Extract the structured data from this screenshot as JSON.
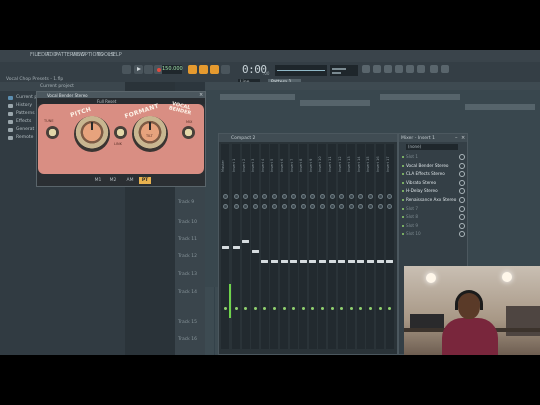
{
  "menu": [
    "FILE",
    "EDIT",
    "ADD",
    "PATTERNS",
    "VIEW",
    "OPTIONS",
    "TOOLS",
    "HELP"
  ],
  "toolbar": {
    "hint": "Vocal Chop Presets - 1.flp",
    "tempo": "150.000",
    "time": "0:00",
    "time_sub": ":00",
    "line_mode": "Line",
    "pattern": "Pattern 1",
    "record_color": "#e04b3f",
    "accent": "#e59a2f"
  },
  "browser": {
    "header": "Current project",
    "items": [
      {
        "label": "Current p",
        "icon": "folder-icon"
      },
      {
        "label": "History",
        "icon": "history-icon"
      },
      {
        "label": "Patterns",
        "icon": "patterns-icon"
      },
      {
        "label": "Effects",
        "icon": "effects-icon"
      },
      {
        "label": "Generat",
        "icon": "generators-icon"
      },
      {
        "label": "Remote",
        "icon": "remote-icon"
      }
    ]
  },
  "tracks": [
    "Track 9",
    "Track 10",
    "Track 11",
    "Track 12",
    "Track 13",
    "Track 14",
    "Track 15",
    "Track 16"
  ],
  "mixer": {
    "title": "Compact 2",
    "strips": [
      "Master",
      "Insert 1",
      "Insert 2",
      "Insert 3",
      "Insert 4",
      "Insert 5",
      "Insert 6",
      "Insert 7",
      "Insert 8",
      "Insert 9",
      "Insert 10",
      "Insert 11",
      "Insert 12",
      "Insert 13",
      "Insert 14",
      "Insert 15",
      "Insert 16",
      "Insert 17"
    ],
    "meter_color": "#6fd34c"
  },
  "insert_panel": {
    "title": "Mixer - Insert 1",
    "input": "(none)",
    "slots": [
      {
        "label": "Slot 1",
        "active": false
      },
      {
        "label": "Vocal Bender Stereo",
        "active": true
      },
      {
        "label": "CLA Effects Stereo",
        "active": true
      },
      {
        "label": "Vibrato Stereo",
        "active": true
      },
      {
        "label": "H-Delay Stereo",
        "active": true
      },
      {
        "label": "Renaissance Axx Stereo",
        "active": true
      },
      {
        "label": "Slot 7",
        "active": false
      },
      {
        "label": "Slot 8",
        "active": false
      },
      {
        "label": "Slot 9",
        "active": false
      },
      {
        "label": "Slot 10",
        "active": false
      }
    ]
  },
  "plugin": {
    "title": "Vocal Bender Stereo",
    "preset": "Full Reset",
    "knobs": {
      "pitch": "PITCH",
      "formant": "FORMANT",
      "tilt": "TILT",
      "mix": "MIX",
      "tune": "TUNE",
      "link": "LINK"
    },
    "brand_line1": "VOCAL",
    "brand_line2": "BENDER",
    "tabs": [
      "M1",
      "M2",
      "AM",
      "PT"
    ],
    "active_tab": "PT",
    "body_color": "#d98e83",
    "tab_color": "#e8b24f"
  }
}
